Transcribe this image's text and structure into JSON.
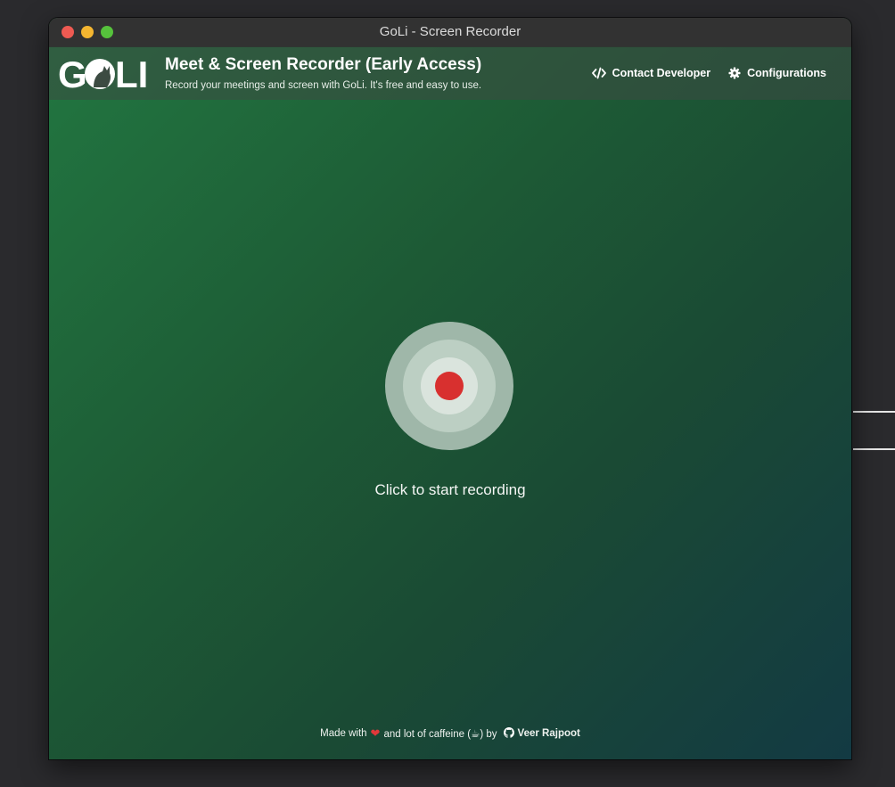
{
  "window": {
    "title": "GoLi - Screen Recorder"
  },
  "header": {
    "logo_text": "GOLI",
    "title": "Meet & Screen Recorder (Early Access)",
    "subtitle": "Record your meetings and screen with GoLi. It's free and easy to use.",
    "nav": [
      {
        "label": "Contact Developer",
        "icon": "code-icon"
      },
      {
        "label": "Configurations",
        "icon": "gear-icon"
      }
    ]
  },
  "main": {
    "record_button_label": "Click to start recording",
    "colors": {
      "record_dot": "#d8302f",
      "outer_ring": "#9fb7a9",
      "middle_ring": "#bccfc3",
      "inner_ring": "#dae4dd"
    }
  },
  "footer": {
    "made_with": "Made with",
    "heart": "❤",
    "and_lot_of_caffeine": "and lot of caffeine (☕) by",
    "author": "Veer Rajpoot",
    "author_icon": "github-icon"
  }
}
